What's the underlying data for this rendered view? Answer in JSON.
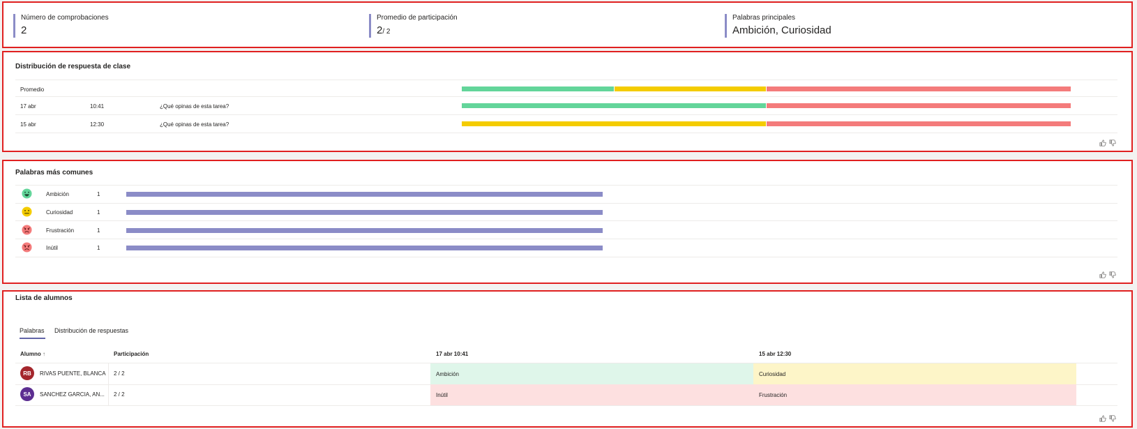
{
  "summary": {
    "checks_label": "Número de comprobaciones",
    "checks_value": "2",
    "participation_label": "Promedio de participación",
    "participation_value": "2",
    "participation_total": "/ 2",
    "top_words_label": "Palabras principales",
    "top_words_value": "Ambición, Curiosidad"
  },
  "distribution": {
    "title": "Distribución de respuesta de clase",
    "average_label": "Promedio",
    "rows": [
      {
        "date": "17 abr",
        "time": "10:41",
        "question": "¿Qué opinas de esta tarea?"
      },
      {
        "date": "15 abr",
        "time": "12:30",
        "question": "¿Qué opinas de esta tarea?"
      }
    ],
    "bars": {
      "average": [
        0.25,
        0.25,
        0.5
      ],
      "row1": [
        0.5,
        0,
        0.5
      ],
      "row2": [
        0,
        0.5,
        0.5
      ]
    }
  },
  "common_words": {
    "title": "Palabras más comunes",
    "items": [
      {
        "word": "Ambición",
        "count": "1",
        "mood": "happy-face-icon"
      },
      {
        "word": "Curiosidad",
        "count": "1",
        "mood": "neutral-face-icon"
      },
      {
        "word": "Frustración",
        "count": "1",
        "mood": "angry-face-icon"
      },
      {
        "word": "Inútil",
        "count": "1",
        "mood": "angry-face-icon"
      }
    ]
  },
  "students": {
    "title": "Lista de alumnos",
    "tabs": [
      "Palabras",
      "Distribución de respuestas"
    ],
    "columns": {
      "student": "Alumno",
      "sort_indicator": "↑",
      "participation": "Participación",
      "check1": "17 abr 10:41",
      "check2": "15 abr 12:30"
    },
    "rows": [
      {
        "initials": "RB",
        "name": "RIVAS PUENTE, BLANCA",
        "participation": "2 / 2",
        "check1": "Ambición",
        "check2": "Curiosidad"
      },
      {
        "initials": "SA",
        "name": "SANCHEZ GARCIA, AN...",
        "participation": "2 / 2",
        "check1": "Inútil",
        "check2": "Frustración"
      }
    ]
  },
  "colors": {
    "positive": "#63d59a",
    "neutral": "#f4cc00",
    "negative": "#f47b7b",
    "bar": "#8b8cc7",
    "positive_bg": "#dff6ea",
    "neutral_bg": "#fdf5c8",
    "negative_bg": "#fde0e0",
    "avatar_rb": "#a4262c",
    "avatar_sa": "#5c2e91",
    "accent": "#6264a7"
  }
}
